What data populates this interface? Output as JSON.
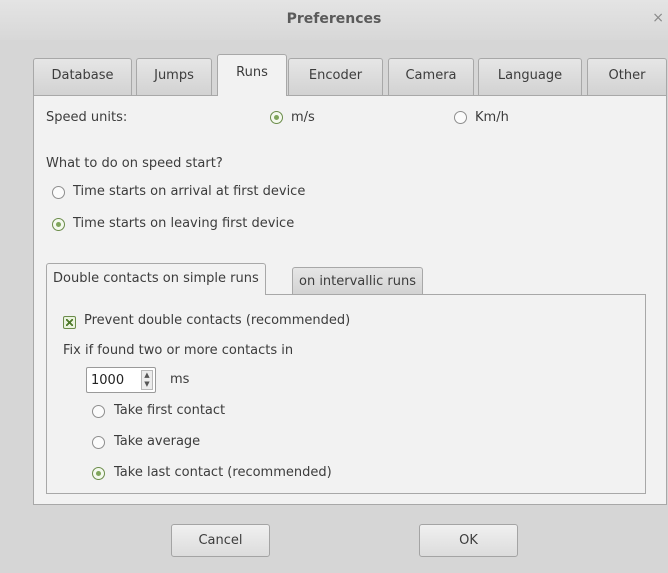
{
  "window": {
    "title": "Preferences",
    "close_glyph": "×"
  },
  "tabs": [
    "Database",
    "Jumps",
    "Runs",
    "Encoder",
    "Camera",
    "Language",
    "Other"
  ],
  "active_tab": "Runs",
  "speed_units": {
    "label": "Speed units:",
    "options": [
      "m/s",
      "Km/h"
    ],
    "selected": "m/s"
  },
  "speed_start": {
    "question": "What to do on speed start?",
    "options": [
      "Time starts on arrival at first device",
      "Time starts on leaving first device"
    ],
    "selected": "Time starts on leaving first device"
  },
  "subtabs": [
    "Double contacts on simple runs",
    "on intervallic runs"
  ],
  "active_subtab": "Double contacts on simple runs",
  "double_contacts": {
    "prevent_label": "Prevent double contacts (recommended)",
    "prevent_checked": true,
    "fix_label": "Fix if found two or more contacts in",
    "ms_value": "1000",
    "ms_unit": "ms",
    "options": [
      "Take first contact",
      "Take average",
      "Take last contact (recommended)"
    ],
    "selected": "Take last contact (recommended)"
  },
  "buttons": {
    "cancel": "Cancel",
    "ok": "OK"
  },
  "icons": {
    "spin_up": "▲",
    "spin_down": "▼"
  },
  "colors": {
    "accent_green": "#7fa55b",
    "background": "#d6d6d6",
    "panel": "#f2f2f2"
  }
}
